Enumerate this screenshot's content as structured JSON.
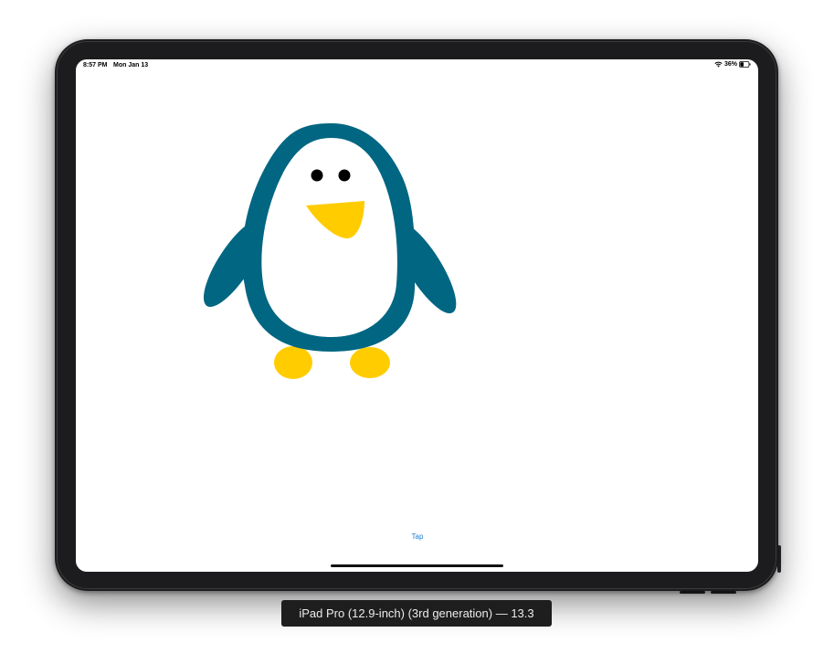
{
  "status_bar": {
    "time": "8:57 PM",
    "date": "Mon Jan 13",
    "battery": "36%",
    "wifi_icon": "wifi-icon",
    "battery_icon": "battery-icon"
  },
  "app": {
    "tap_button_label": "Tap",
    "colors": {
      "penguin_body": "#006682",
      "penguin_belly": "#ffffff",
      "penguin_beak_feet": "#ffcc00",
      "penguin_eyes": "#000000",
      "tap_text": "#1a7fd6"
    }
  },
  "simulator": {
    "device_label": "iPad Pro (12.9-inch) (3rd generation) — 13.3"
  }
}
